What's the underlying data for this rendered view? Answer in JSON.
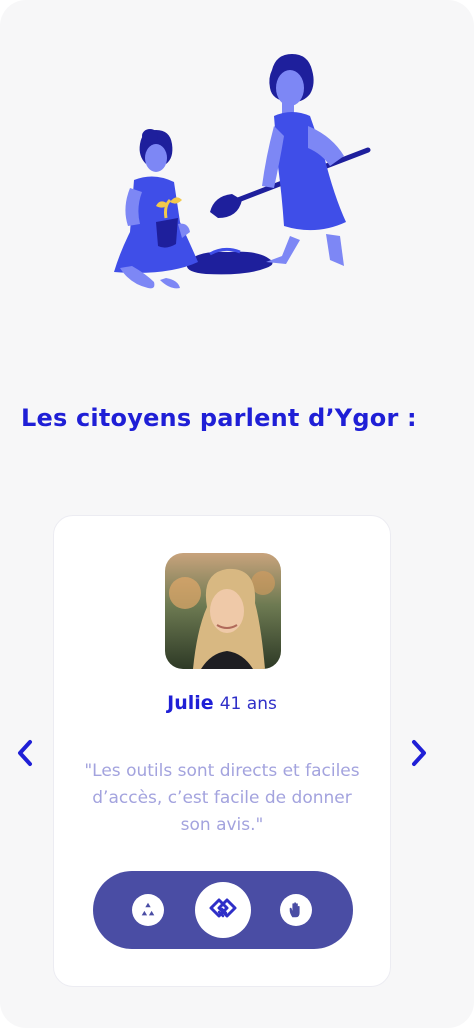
{
  "section": {
    "title": "Les citoyens parlent d’Ygor :"
  },
  "testimonial": {
    "name": "Julie",
    "age": "41 ans",
    "quote": "\"Les outils sont directs et faciles d’accès, c’est facile de donner son avis.\""
  },
  "icons": {
    "prev": "chevron-left-icon",
    "next": "chevron-right-icon",
    "recycle": "recycle-icon",
    "handshake": "handshake-icon",
    "hand": "raised-hand-icon"
  },
  "colors": {
    "accent": "#1f1fd6",
    "pill": "#4a4da4",
    "quote": "#a3a3de",
    "illustration": "#3f4ee8",
    "illustration_dark": "#1e1f9c",
    "background": "#f7f7f8"
  }
}
